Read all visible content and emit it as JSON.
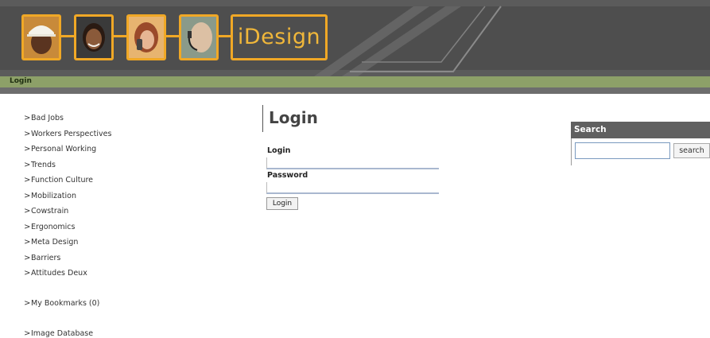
{
  "header": {
    "logo_text": "iDesign",
    "accent_color": "#f0a826"
  },
  "breadcrumb": {
    "label": "Login"
  },
  "sidebar": {
    "items": [
      {
        "label": "Bad Jobs"
      },
      {
        "label": "Workers Perspectives"
      },
      {
        "label": "Personal Working"
      },
      {
        "label": "Trends"
      },
      {
        "label": "Function Culture"
      },
      {
        "label": "Mobilization"
      },
      {
        "label": "Cowstrain"
      },
      {
        "label": "Ergonomics"
      },
      {
        "label": "Meta Design"
      },
      {
        "label": "Barriers"
      },
      {
        "label": "Attitudes Deux"
      },
      {
        "label": "My Bookmarks (0)"
      },
      {
        "label": "Image Database"
      }
    ]
  },
  "main": {
    "title": "Login",
    "login_label": "Login",
    "password_label": "Password",
    "login_value": "",
    "password_value": "",
    "submit_label": "Login"
  },
  "search": {
    "heading": "Search",
    "input_value": "",
    "button_label": "search"
  }
}
